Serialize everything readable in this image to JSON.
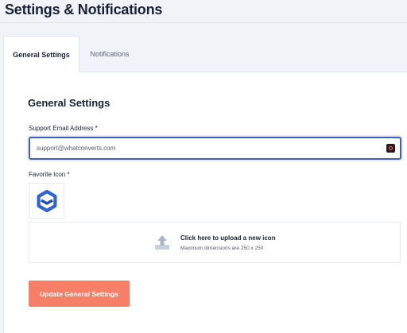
{
  "page": {
    "title": "Settings & Notifications"
  },
  "tabs": [
    {
      "label": "General Settings",
      "active": true
    },
    {
      "label": "Notifications",
      "active": false
    }
  ],
  "general": {
    "section_title": "General Settings",
    "email_label": "Support Email Address *",
    "email_value": "support@whatconverts.com",
    "icon_label": "Favorite Icon *",
    "icon_preview": "whatconverts-logo-icon",
    "upload_text": "Click here to upload a new icon",
    "upload_hint": "Maximum dimensions are 250 x 250",
    "submit_label": "Update General Settings"
  },
  "colors": {
    "accent_button": "#f77f68",
    "focus_border": "#3d5fb6",
    "logo_blue": "#2f64d6",
    "title_text": "#1a2036",
    "page_bg": "#f0f4f9"
  },
  "icons": {
    "upload": "upload-icon",
    "autofill": "password-manager-icon"
  }
}
